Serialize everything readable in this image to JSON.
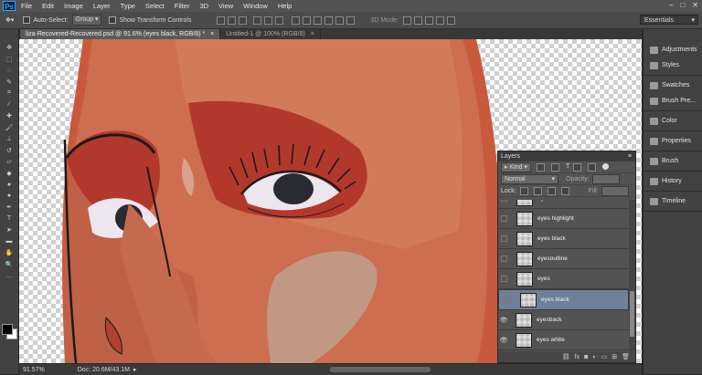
{
  "app": {
    "logo": "Ps",
    "menu": [
      "File",
      "Edit",
      "Image",
      "Layer",
      "Type",
      "Select",
      "Filter",
      "3D",
      "View",
      "Window",
      "Help"
    ]
  },
  "options": {
    "auto_select_label": "Auto-Select:",
    "auto_select_value": "Group",
    "transform_label": "Show Transform Controls",
    "mode_3d": "3D Mode:",
    "workspace": "Essentials"
  },
  "tabs": [
    {
      "label": "liza-Recovered-Recovered.psd @ 91.6% (eyes black, RGB/8) *"
    },
    {
      "label": "Untitled-1 @ 100% (RGB/8)"
    }
  ],
  "status": {
    "zoom": "91.57%",
    "doc": "Doc: 20.6M/43.1M"
  },
  "dock": [
    {
      "label": "Adjustments",
      "icon": "adjustments-icon"
    },
    {
      "label": "Styles",
      "icon": "styles-icon"
    },
    {
      "label": "Swatches",
      "icon": "swatches-icon"
    },
    {
      "label": "Brush Pre...",
      "icon": "brush-presets-icon"
    },
    {
      "label": "Color",
      "icon": "color-icon"
    },
    {
      "label": "Properties",
      "icon": "properties-icon"
    },
    {
      "label": "Brush",
      "icon": "brush-icon"
    },
    {
      "label": "History",
      "icon": "history-icon"
    },
    {
      "label": "Timeline",
      "icon": "timeline-icon"
    }
  ],
  "layers_panel": {
    "title": "Layers",
    "kind": "Kind",
    "blend": "Normal",
    "opacity_label": "Opacity:",
    "lock_label": "Lock:",
    "fill_label": "Fill:",
    "layers": [
      {
        "name": "eyelashes",
        "visible": false,
        "selected": false
      },
      {
        "name": "eyes highlight",
        "visible": false,
        "selected": false
      },
      {
        "name": "eyes black",
        "visible": false,
        "selected": false
      },
      {
        "name": "eyesoutline",
        "visible": false,
        "selected": false
      },
      {
        "name": "eyes",
        "visible": false,
        "selected": false
      },
      {
        "name": "eyes black",
        "visible": false,
        "selected": true
      },
      {
        "name": "eyesback",
        "visible": true,
        "selected": false
      },
      {
        "name": "eyes white",
        "visible": true,
        "selected": false
      }
    ]
  },
  "colors": {
    "accent": "#30a8ff",
    "selected_layer": "#6f8098"
  }
}
